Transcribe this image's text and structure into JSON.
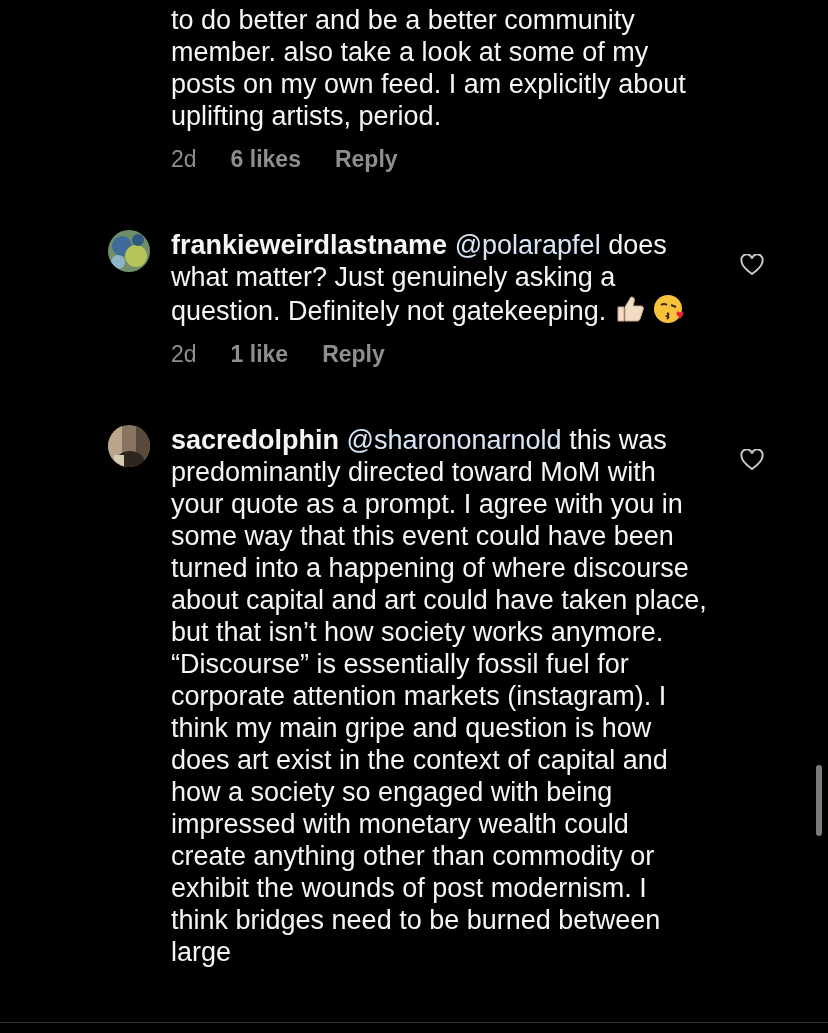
{
  "comments": [
    {
      "text": "to do better and be a better community member. also take a look at some of my posts on my own feed. I am explicitly about uplifting artists, period.",
      "time": "2d",
      "likes": "6 likes",
      "reply": "Reply"
    },
    {
      "avatar": {
        "kind": "picture"
      },
      "username": "frankieweirdlastname",
      "mention": "@polarapfel",
      "text": "does what matter? Just genuinely asking a question. Definitely not gatekeeping.",
      "trailing_icons": [
        {
          "kind": "thumbs_up"
        },
        {
          "kind": "kiss_face"
        }
      ],
      "liked": false,
      "time": "2d",
      "likes": "1 like",
      "reply": "Reply"
    },
    {
      "avatar": {
        "kind": "picture"
      },
      "username": "sacredolphin",
      "mention": "@sharononarnold",
      "text": "this was predominantly directed toward MoM with your quote as a prompt. I agree with you in some way that this event could have been turned into a happening of where discourse about capital and art could have taken place, but that isn’t how society works anymore. “Discourse” is essentially fossil fuel for corporate attention markets (instagram). I think my main gripe and question is how does art exist in the context of capital and how a society so engaged with being impressed with monetary wealth could create anything other than commodity or exhibit the wounds of post modernism. I think bridges need to be burned between large",
      "liked": false
    }
  ]
}
